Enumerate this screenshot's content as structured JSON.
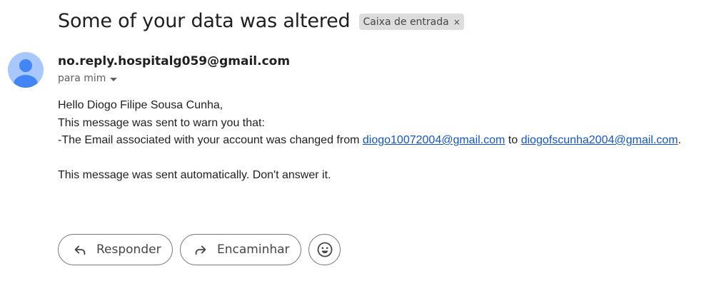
{
  "email": {
    "subject": "Some of your data was altered",
    "label_chip": "Caixa de entrada",
    "label_chip_close": "×",
    "sender": "no.reply.hospitalg059@gmail.com",
    "recipient": "para mim",
    "body": {
      "greeting": "Hello Diogo Filipe Sousa Cunha,",
      "line1": "This message was sent to warn you that:",
      "line2_prefix": "-The Email associated with your account was changed from ",
      "old_email": "diogo10072004@gmail.com",
      "line2_middle": " to ",
      "new_email": "diogofscunha2004@gmail.com",
      "line2_suffix": ".",
      "footer": "This message was sent automatically. Don't answer it."
    }
  },
  "actions": {
    "reply_label": "Responder",
    "forward_label": "Encaminhar",
    "reply_icon": "reply-arrow",
    "forward_icon": "forward-arrow",
    "emoji_icon": "smiley-face"
  },
  "colors": {
    "link": "#1155cc",
    "avatar_bg": "#a8c7fa",
    "avatar_fg": "#4285f4",
    "chip_bg": "#dddddd"
  }
}
